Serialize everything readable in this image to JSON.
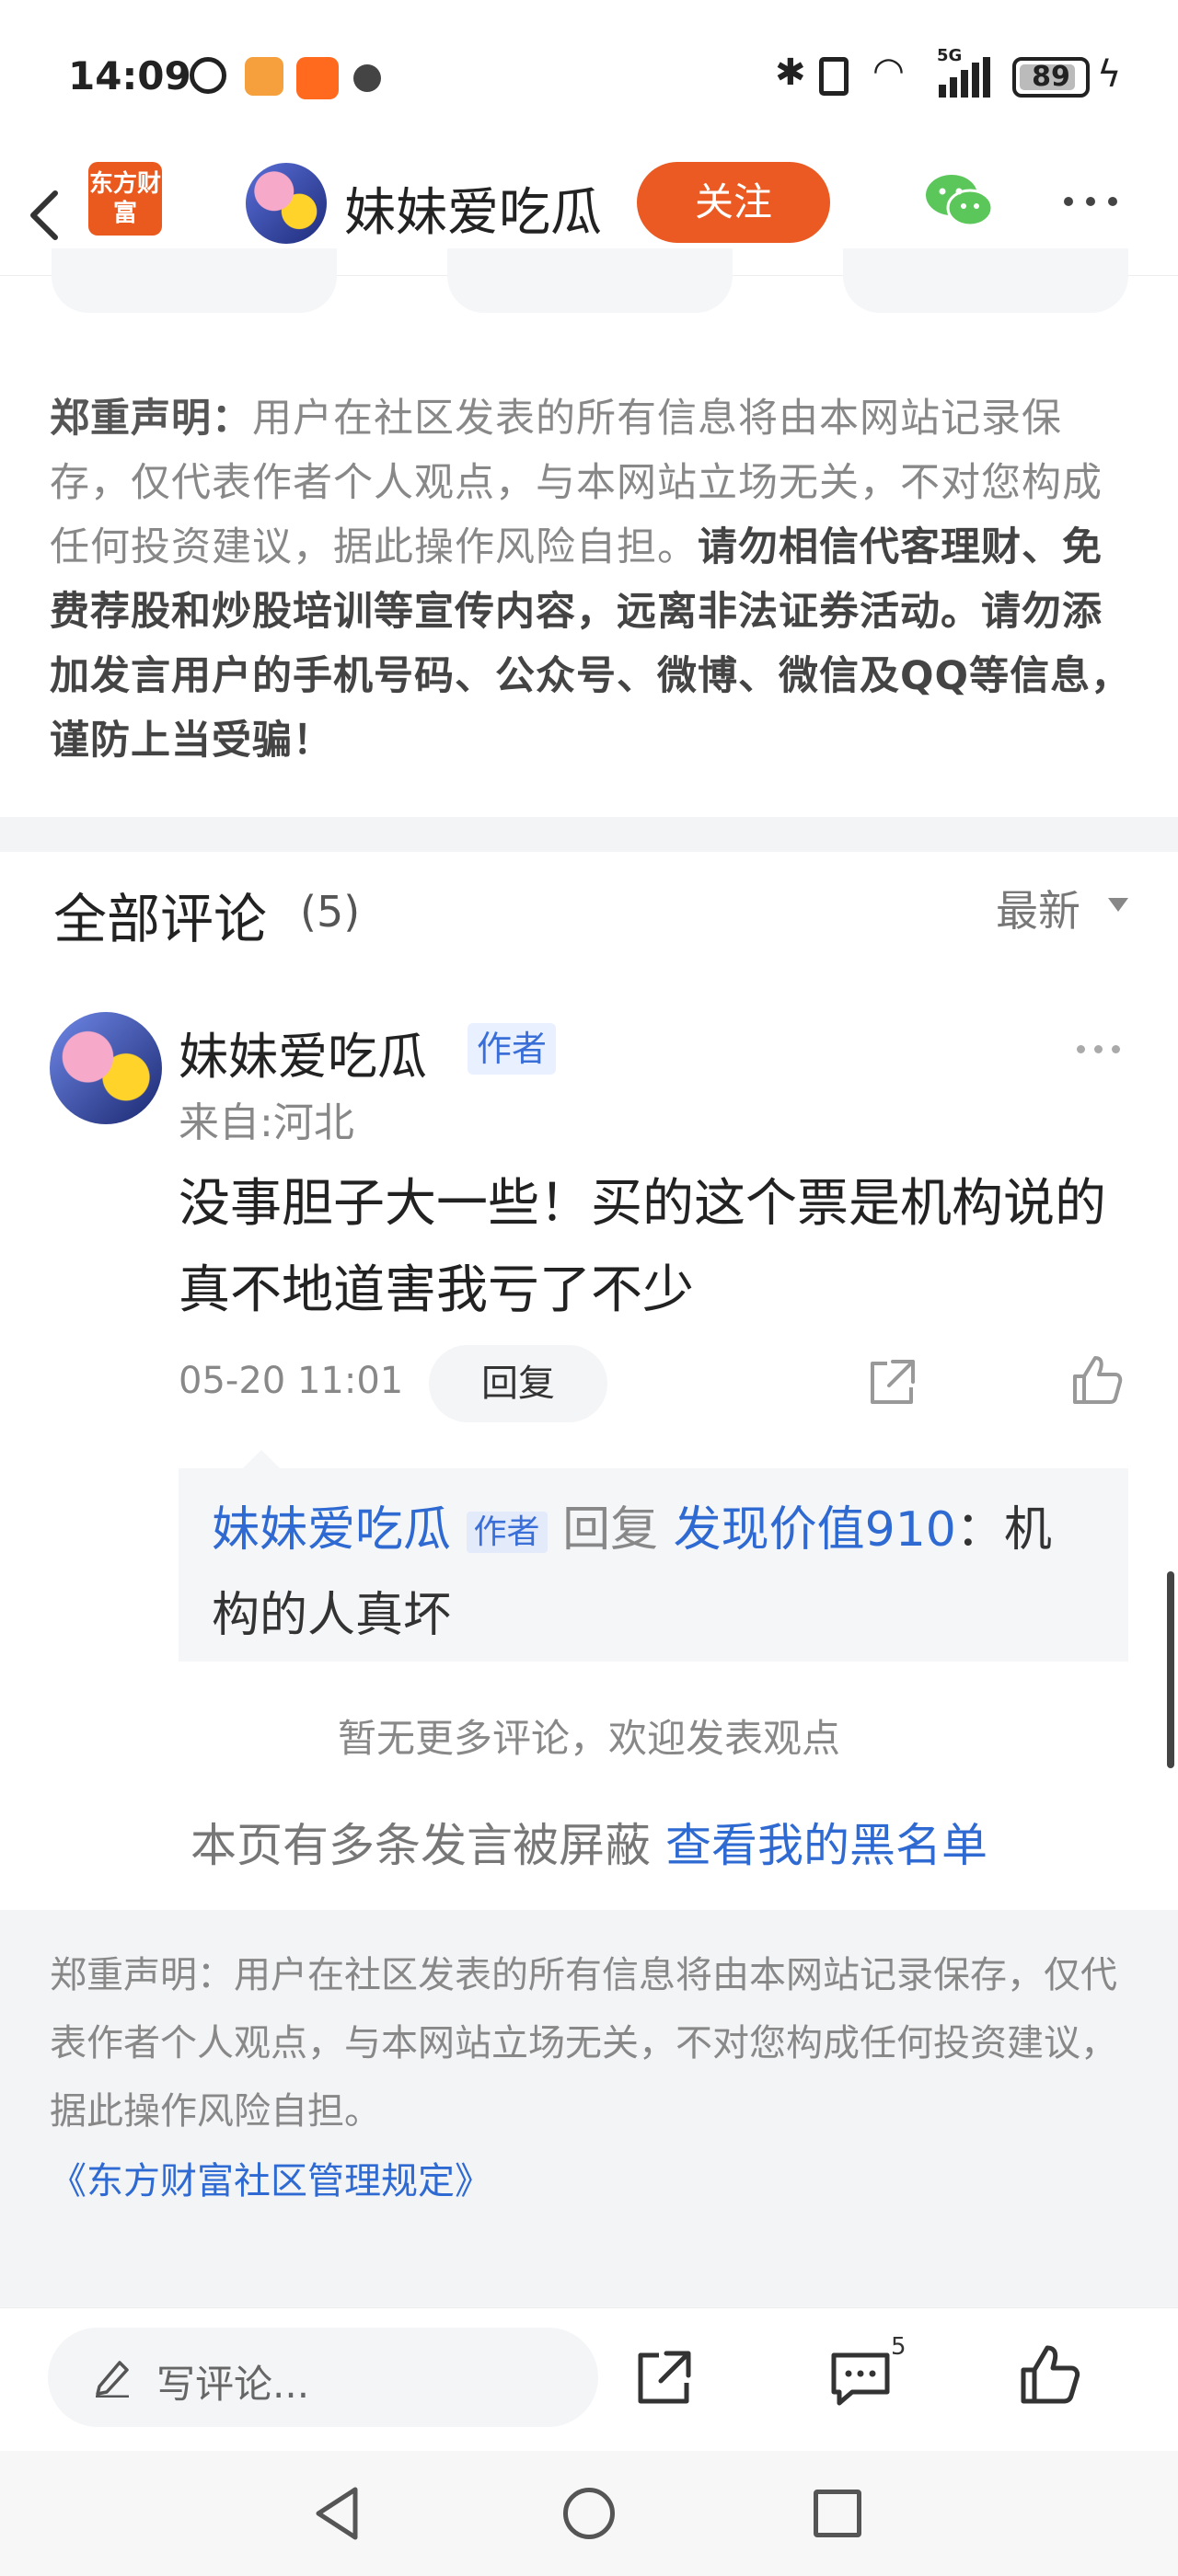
{
  "status_bar": {
    "time": "14:09",
    "battery": "89",
    "network": "5G"
  },
  "header": {
    "logo_text": "东方财富",
    "username": "妹妹爱吃瓜",
    "follow_label": "关注"
  },
  "disclaimer": {
    "label": "郑重声明：",
    "normal": "用户在社区发表的所有信息将由本网站记录保存，仅代表作者个人观点，与本网站立场无关，不对您构成任何投资建议，据此操作风险自担。",
    "bold": "请勿相信代客理财、免费荐股和炒股培训等宣传内容，远离非法证券活动。请勿添加发言用户的手机号码、公众号、微博、微信及QQ等信息，谨防上当受骗！"
  },
  "comments": {
    "title": "全部评论",
    "count": "(5)",
    "sort_label": "最新",
    "items": [
      {
        "author": "妹妹爱吃瓜",
        "author_tag": "作者",
        "location": "来自:河北",
        "text": "没事胆子大一些！买的这个票是机构说的真不地道害我亏了不少",
        "time": "05-20 11:01",
        "reply_label": "回复",
        "replies": [
          {
            "author": "妹妹爱吃瓜",
            "author_tag": "作者",
            "reply_word": "回复",
            "target": "发现价值910",
            "separator": "：",
            "text": "机构的人真坏"
          }
        ]
      }
    ],
    "no_more": "暂无更多评论，欢迎发表观点",
    "blocked_text": "本页有多条发言被屏蔽",
    "blocked_link": "查看我的黑名单"
  },
  "footer": {
    "text": "郑重声明：用户在社区发表的所有信息将由本网站记录保存，仅代表作者个人观点，与本网站立场无关，不对您构成任何投资建议，据此操作风险自担。",
    "link": "《东方财富社区管理规定》"
  },
  "bottom_bar": {
    "comment_placeholder": "写评论...",
    "comment_count": "5"
  },
  "colors": {
    "accent": "#ea5a22",
    "link": "#2e6ad1",
    "author_tag_bg": "#e9f0ff"
  },
  "icons": [
    "back-icon",
    "wechat-icon",
    "more-icon",
    "share-icon",
    "like-icon",
    "pencil-icon",
    "comment-icon"
  ]
}
